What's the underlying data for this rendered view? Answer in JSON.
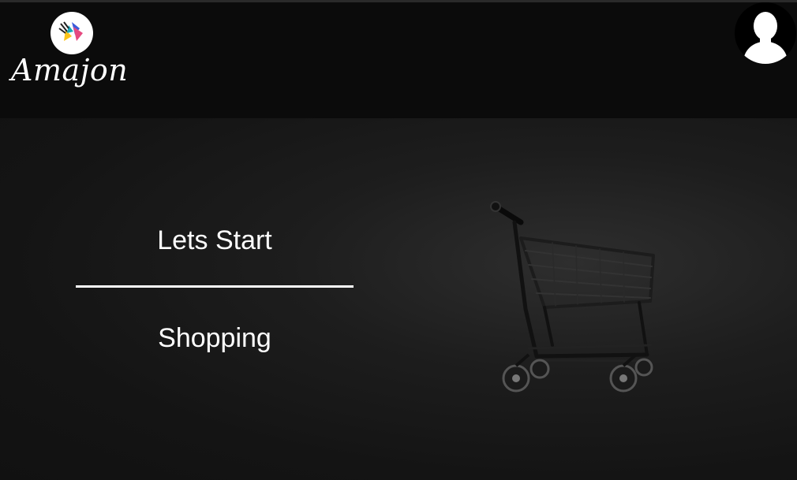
{
  "header": {
    "brand_name": "Amajon",
    "logo_icon": "paint-splash-logo-icon",
    "avatar_icon": "user-silhouette-icon"
  },
  "hero": {
    "line1": "Lets Start",
    "line2": "Shopping",
    "image_icon": "shopping-cart-icon"
  },
  "colors": {
    "header_bg": "#0b0b0b",
    "main_bg": "#141414",
    "text": "#ffffff"
  }
}
